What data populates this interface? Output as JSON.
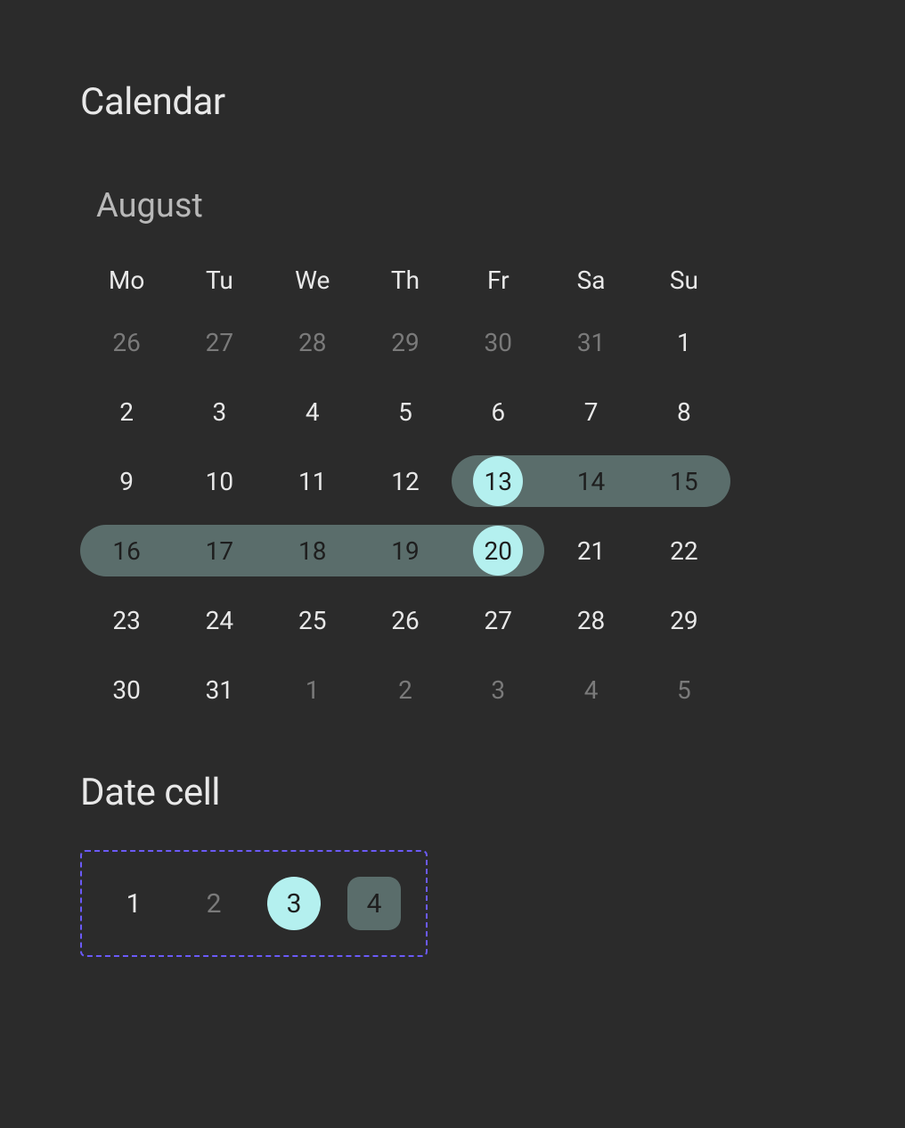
{
  "title": "Calendar",
  "month": "August",
  "weekdays": [
    "Mo",
    "Tu",
    "We",
    "Th",
    "Fr",
    "Sa",
    "Su"
  ],
  "grid": [
    [
      {
        "d": "26",
        "other": true
      },
      {
        "d": "27",
        "other": true
      },
      {
        "d": "28",
        "other": true
      },
      {
        "d": "29",
        "other": true
      },
      {
        "d": "30",
        "other": true
      },
      {
        "d": "31",
        "other": true
      },
      {
        "d": "1"
      }
    ],
    [
      {
        "d": "2"
      },
      {
        "d": "3"
      },
      {
        "d": "4"
      },
      {
        "d": "5"
      },
      {
        "d": "6"
      },
      {
        "d": "7"
      },
      {
        "d": "8"
      }
    ],
    [
      {
        "d": "9"
      },
      {
        "d": "10"
      },
      {
        "d": "11"
      },
      {
        "d": "12"
      },
      {
        "d": "13",
        "range": true,
        "range_start": true,
        "endpoint": true
      },
      {
        "d": "14",
        "range": true
      },
      {
        "d": "15",
        "range": true,
        "range_end": true
      }
    ],
    [
      {
        "d": "16",
        "range": true,
        "range_start": true
      },
      {
        "d": "17",
        "range": true
      },
      {
        "d": "18",
        "range": true
      },
      {
        "d": "19",
        "range": true
      },
      {
        "d": "20",
        "range": true,
        "range_end": true,
        "endpoint": true
      },
      {
        "d": "21"
      },
      {
        "d": "22"
      }
    ],
    [
      {
        "d": "23"
      },
      {
        "d": "24"
      },
      {
        "d": "25"
      },
      {
        "d": "26"
      },
      {
        "d": "27"
      },
      {
        "d": "28"
      },
      {
        "d": "29"
      }
    ],
    [
      {
        "d": "30"
      },
      {
        "d": "31"
      },
      {
        "d": "1",
        "other": true
      },
      {
        "d": "2",
        "other": true
      },
      {
        "d": "3",
        "other": true
      },
      {
        "d": "4",
        "other": true
      },
      {
        "d": "5",
        "other": true
      }
    ]
  ],
  "date_cell_title": "Date cell",
  "examples": [
    {
      "d": "1",
      "variant": "normal"
    },
    {
      "d": "2",
      "variant": "muted"
    },
    {
      "d": "3",
      "variant": "selected"
    },
    {
      "d": "4",
      "variant": "range-style"
    }
  ]
}
